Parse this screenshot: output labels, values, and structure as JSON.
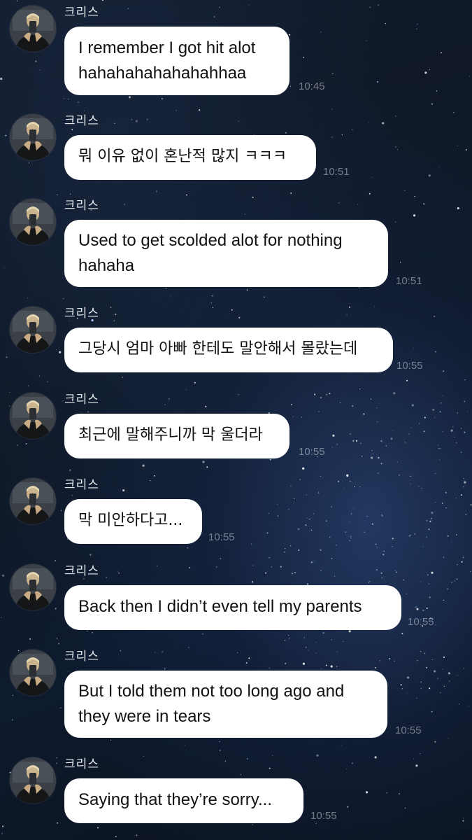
{
  "chat": {
    "sender_name": "크리스",
    "messages": [
      {
        "text": "I remember I got hit alot hahahahahahahahhaa",
        "time": "10:45"
      },
      {
        "text": "뭐 이유 없이 혼난적 많지 ㅋㅋㅋ",
        "time": "10:51"
      },
      {
        "text": "Used to get scolded alot for nothing hahaha",
        "time": "10:51"
      },
      {
        "text": "그당시 엄마 아빠 한테도 말안해서 몰랐는데",
        "time": "10:55"
      },
      {
        "text": "최근에 말해주니까 막 울더라",
        "time": "10:55"
      },
      {
        "text": "막 미안하다고...",
        "time": "10:55"
      },
      {
        "text": "Back then I didn’t even tell my parents",
        "time": "10:55"
      },
      {
        "text": "But I told them not too long ago and they were in tears",
        "time": "10:55"
      },
      {
        "text": "Saying that they’re sorry...",
        "time": "10:55"
      }
    ]
  }
}
